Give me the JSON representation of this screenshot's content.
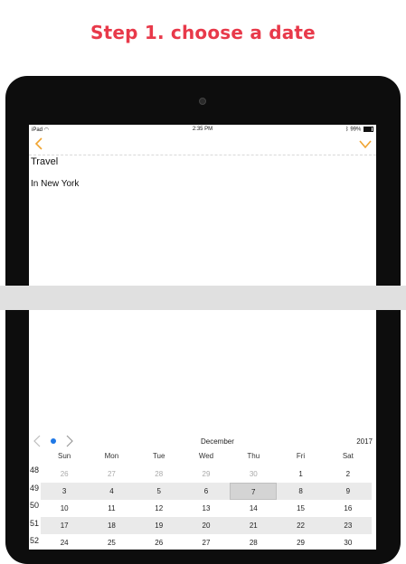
{
  "headline": "Step 1. choose a date",
  "status": {
    "device": "iPad",
    "time": "2:35 PM",
    "battery": "99%"
  },
  "nav": {
    "back_icon": "chevron-left-icon",
    "done_icon": "checkmark-icon",
    "accent": "#f0a431"
  },
  "event": {
    "title": "Travel",
    "location": "In New York"
  },
  "calendar": {
    "month": "December",
    "year": "2017",
    "weekdays": [
      "Sun",
      "Mon",
      "Tue",
      "Wed",
      "Thu",
      "Fri",
      "Sat"
    ],
    "week_numbers": [
      "48",
      "49",
      "50",
      "51",
      "52"
    ],
    "weeks": [
      [
        "26",
        "27",
        "28",
        "29",
        "30",
        "1",
        "2"
      ],
      [
        "3",
        "4",
        "5",
        "6",
        "7",
        "8",
        "9"
      ],
      [
        "10",
        "11",
        "12",
        "13",
        "14",
        "15",
        "16"
      ],
      [
        "17",
        "18",
        "19",
        "20",
        "21",
        "22",
        "23"
      ],
      [
        "24",
        "25",
        "26",
        "27",
        "28",
        "29",
        "30"
      ]
    ],
    "selected": "7",
    "page_dot_color": "#1f78e6"
  }
}
